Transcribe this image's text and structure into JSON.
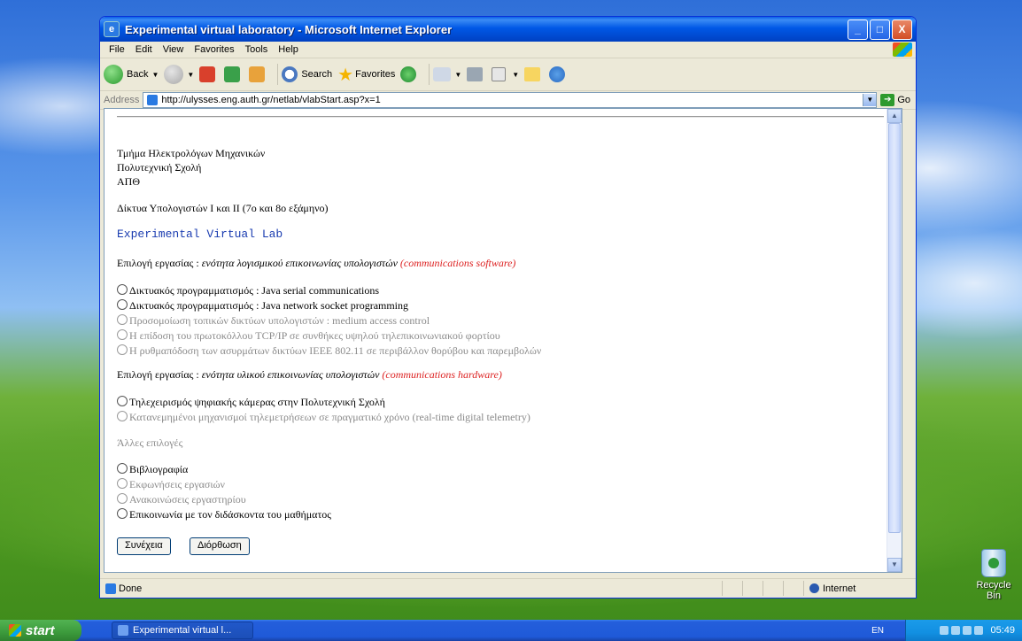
{
  "window": {
    "title": "Experimental virtual laboratory - Microsoft Internet Explorer",
    "controls": {
      "minimize": "_",
      "maximize": "□",
      "close": "X"
    }
  },
  "menu": [
    "File",
    "Edit",
    "View",
    "Favorites",
    "Tools",
    "Help"
  ],
  "toolbar": {
    "back_label": "Back",
    "search_label": "Search",
    "favorites_label": "Favorites"
  },
  "address": {
    "label": "Address",
    "url": "http://ulysses.eng.auth.gr/netlab/vlabStart.asp?x=1",
    "go_label": "Go"
  },
  "page": {
    "org_line1": "Τμήμα Ηλεκτρολόγων Μηχανικών",
    "org_line2": "Πολυτεχνική Σχολή",
    "org_line3": "ΑΠΘ",
    "course": "Δίκτυα Υπολογιστών Ι και ΙΙ (7ο και 8ο εξάμηνο)",
    "lab_title": "Experimental Virtual Lab",
    "section_software": {
      "lead": "Επιλογή εργασίας : ",
      "topic": "ενότητα λογισμικού επικοινωνίας υπολογιστών ",
      "tag": "(communications software)"
    },
    "software_options": [
      "Δικτυακός προγραμματισμός : Java serial communications",
      "Δικτυακός προγραμματισμός : Java network socket programming",
      "Προσομοίωση τοπικών δικτύων υπολογιστών : medium access control",
      "Η επίδοση του πρωτοκόλλου TCP/IP σε συνθήκες υψηλού τηλεπικοινωνιακού φορτίου",
      "Η ρυθμαπόδοση των ασυρμάτων δικτύων IEEE 802.11 σε περιβάλλον θορύβου και παρεμβολών"
    ],
    "section_hardware": {
      "lead": "Επιλογή εργασίας : ",
      "topic": "ενότητα υλικού επικοινωνίας υπολογιστών ",
      "tag": "(communications hardware)"
    },
    "hardware_options": [
      "Τηλεχειρισμός ψηφιακής κάμερας στην Πολυτεχνική Σχολή",
      "Κατανεμημένοι μηχανισμοί τηλεμετρήσεων σε πραγματικό χρόνο (real-time digital telemetry)"
    ],
    "other_heading": "Άλλες επιλογές",
    "other_options": [
      "Βιβλιογραφία",
      "Εκφωνήσεις εργασιών",
      "Ανακοινώσεις εργαστηρίου",
      "Επικοινωνία με τον διδάσκοντα του μαθήματος"
    ],
    "continue_button": "Συνέχεια",
    "reset_button": "Διόρθωση"
  },
  "status": {
    "text": "Done",
    "zone": "Internet"
  },
  "desktop": {
    "recycle_bin": "Recycle Bin"
  },
  "taskbar": {
    "start": "start",
    "task_item": "Experimental virtual l...",
    "language": "EN",
    "clock": "05:49"
  }
}
